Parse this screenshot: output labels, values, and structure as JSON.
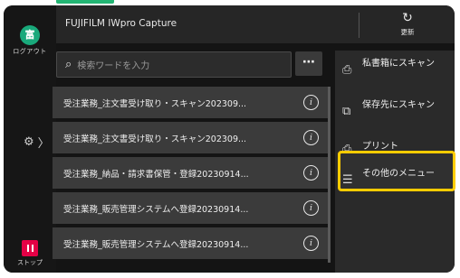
{
  "app": {
    "title": "FUJIFILM IWpro Capture"
  },
  "rail": {
    "login_glyph": "富",
    "login_label": "ログアウト",
    "settings_chevron": "〉",
    "stop_label": "ストップ"
  },
  "header": {
    "refresh_label": "更新"
  },
  "search": {
    "placeholder": "検索ワードを入力",
    "more_label": "⋯"
  },
  "list": {
    "items": [
      {
        "name": "受注業務_注文書受け取り・スキャン202309..."
      },
      {
        "name": "受注業務_注文書受け取り・スキャン202309..."
      },
      {
        "name": "受注業務_納品・請求書保管・登録20230914..."
      },
      {
        "name": "受注業務_販売管理システムへ登録20230914..."
      },
      {
        "name": "受注業務_販売管理システムへ登録20230914..."
      }
    ]
  },
  "panel": {
    "items": [
      {
        "label": "私書箱にスキャン",
        "icon": "mailbox-scan-icon"
      },
      {
        "label": "保存先にスキャン",
        "icon": "folder-scan-icon"
      },
      {
        "label": "プリント",
        "icon": "printer-icon"
      },
      {
        "label": "その他のメニュー",
        "icon": "menu-icon"
      }
    ]
  },
  "colors": {
    "accent_green": "#19a97b",
    "stop_red": "#e40046",
    "highlight": "#ffcc00"
  }
}
